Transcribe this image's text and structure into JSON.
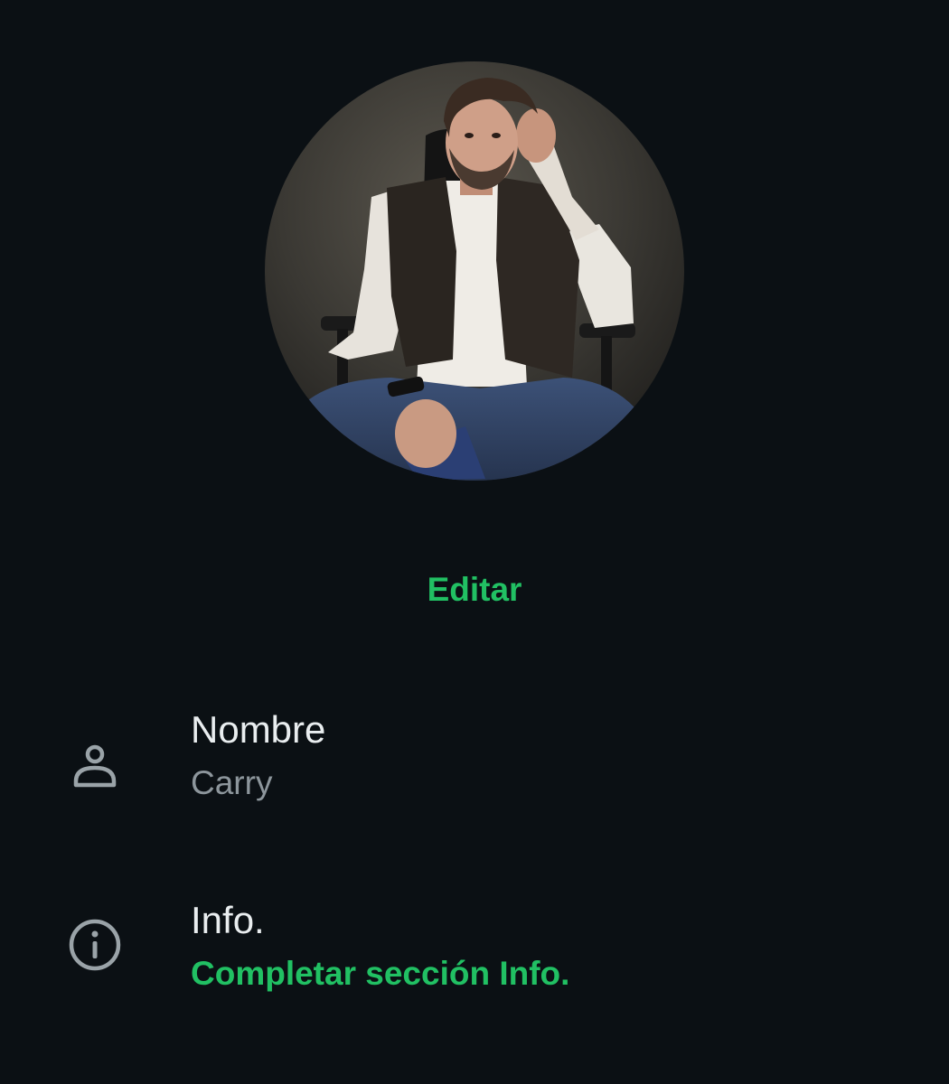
{
  "profile": {
    "photo_alt": "Foto de perfil",
    "edit_label": "Editar"
  },
  "fields": {
    "name": {
      "label": "Nombre",
      "value": "Carry",
      "icon": "person-icon"
    },
    "info": {
      "label": "Info.",
      "value": "Completar sección Info.",
      "icon": "info-icon"
    }
  },
  "colors": {
    "background": "#0b1014",
    "accent": "#21c063",
    "primary_text": "#e9edef",
    "secondary_text": "#8d969c",
    "icon": "#9aa3a8"
  }
}
